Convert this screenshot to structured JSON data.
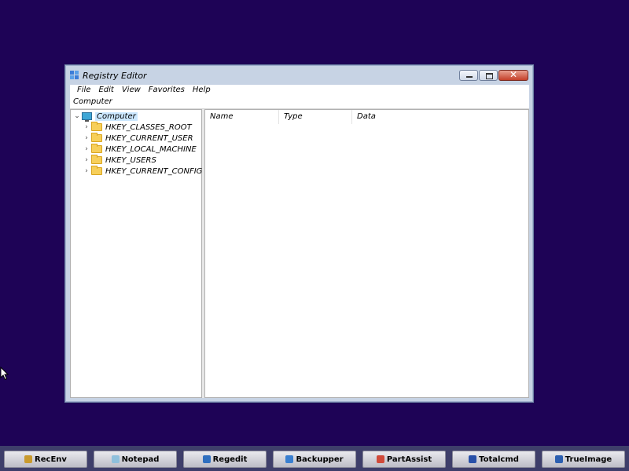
{
  "window": {
    "title": "Registry Editor",
    "close_glyph": "✕"
  },
  "menu": [
    "File",
    "Edit",
    "View",
    "Favorites",
    "Help"
  ],
  "address": "Computer",
  "tree": {
    "root": {
      "label": "Computer",
      "chevron": "⌄"
    },
    "items": [
      {
        "label": "HKEY_CLASSES_ROOT",
        "chevron": "›"
      },
      {
        "label": "HKEY_CURRENT_USER",
        "chevron": "›"
      },
      {
        "label": "HKEY_LOCAL_MACHINE",
        "chevron": "›"
      },
      {
        "label": "HKEY_USERS",
        "chevron": "›"
      },
      {
        "label": "HKEY_CURRENT_CONFIG",
        "chevron": "›"
      }
    ]
  },
  "list": {
    "columns": [
      "Name",
      "Type",
      "Data"
    ]
  },
  "taskbar": {
    "buttons": [
      {
        "label": "RecEnv",
        "icon": "recenv-icon",
        "color": "#c99a2e"
      },
      {
        "label": "Notepad",
        "icon": "notepad-icon",
        "color": "#8fc0dc"
      },
      {
        "label": "Regedit",
        "icon": "regedit-icon",
        "color": "#2f6fbf"
      },
      {
        "label": "Backupper",
        "icon": "backupper-icon",
        "color": "#3a7fd0"
      },
      {
        "label": "PartAssist",
        "icon": "partassist-icon",
        "color": "#d04a3a"
      },
      {
        "label": "Totalcmd",
        "icon": "totalcmd-icon",
        "color": "#2850a8"
      },
      {
        "label": "TrueImage",
        "icon": "trueimage-icon",
        "color": "#2c5fb0"
      }
    ]
  },
  "colors": {
    "desktop": "#1e0356",
    "taskbar": "#3e3e6a",
    "selection": "#cce8ff"
  }
}
